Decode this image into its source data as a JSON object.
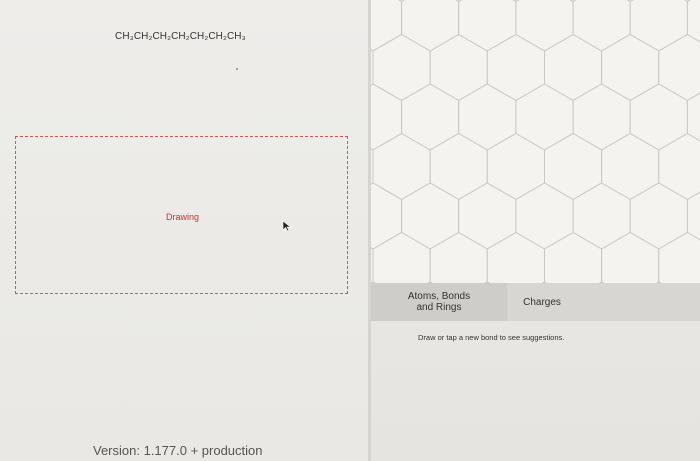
{
  "formula": "CH₃CH₂CH₂CH₂CH₂CH₂CH₃",
  "drawing_area": {
    "label": "Drawing"
  },
  "footer": {
    "version": "Version: 1.177.0 + production"
  },
  "tabs": [
    {
      "label_line1": "Atoms, Bonds",
      "label_line2": "and Rings"
    },
    {
      "label": "Charges"
    }
  ],
  "hint": "Draw or tap a new bond to see suggestions.",
  "colors": {
    "drawing_border": "#d9534f",
    "drawing_label": "#c9302c",
    "hex_stroke": "#c9c7c3"
  }
}
